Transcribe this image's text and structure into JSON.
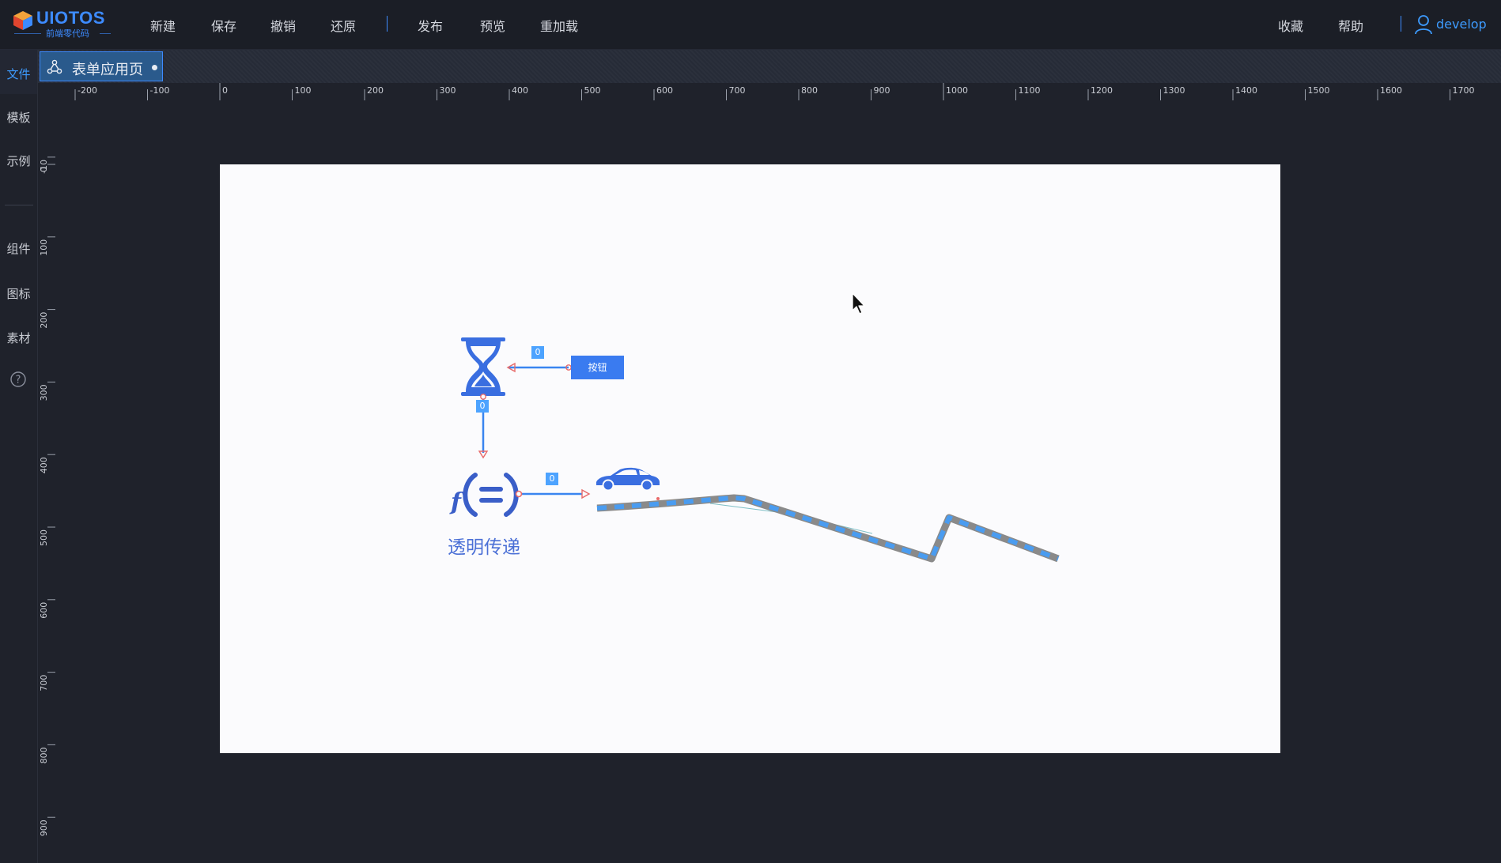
{
  "app": {
    "logo_text": "UIOTOS",
    "logo_subtitle": "前端零代码"
  },
  "menu": {
    "left": [
      "新建",
      "保存",
      "撤销",
      "还原",
      "发布",
      "预览",
      "重加载"
    ],
    "right": [
      "收藏",
      "帮助"
    ]
  },
  "user": {
    "name": "develop",
    "icon": "user-icon"
  },
  "sidebar": {
    "items": [
      {
        "label": "文件",
        "active": true
      },
      {
        "label": "模板"
      },
      {
        "label": "示例"
      },
      {
        "label": "组件"
      },
      {
        "label": "图标"
      },
      {
        "label": "素材"
      }
    ],
    "help_icon": "question-circle-icon"
  },
  "tab": {
    "label": "表单应用页",
    "icon": "node-graph-icon",
    "modified": true
  },
  "ruler": {
    "horizontal": [
      "-200",
      "-100",
      "0",
      "100",
      "200",
      "300",
      "400",
      "500",
      "600",
      "700",
      "800",
      "900",
      "1000",
      "1100",
      "1200",
      "1300",
      "1400",
      "1500",
      "1600",
      "1700"
    ],
    "vertical": [
      "-10",
      "0",
      "100",
      "200",
      "300",
      "400",
      "500",
      "600",
      "700",
      "800",
      "900"
    ]
  },
  "canvas": {
    "button_label": "按钮",
    "badges": [
      "0",
      "0",
      "0"
    ],
    "function_label": "透明传递",
    "icons": [
      "hourglass-icon",
      "function-icon",
      "car-icon"
    ]
  },
  "colors": {
    "accent": "#3d8bff",
    "node_blue": "#3a7bf0",
    "badge_blue": "#4da3ff",
    "path_gray": "#8a8a8a",
    "path_blue": "#4a9cf0"
  }
}
